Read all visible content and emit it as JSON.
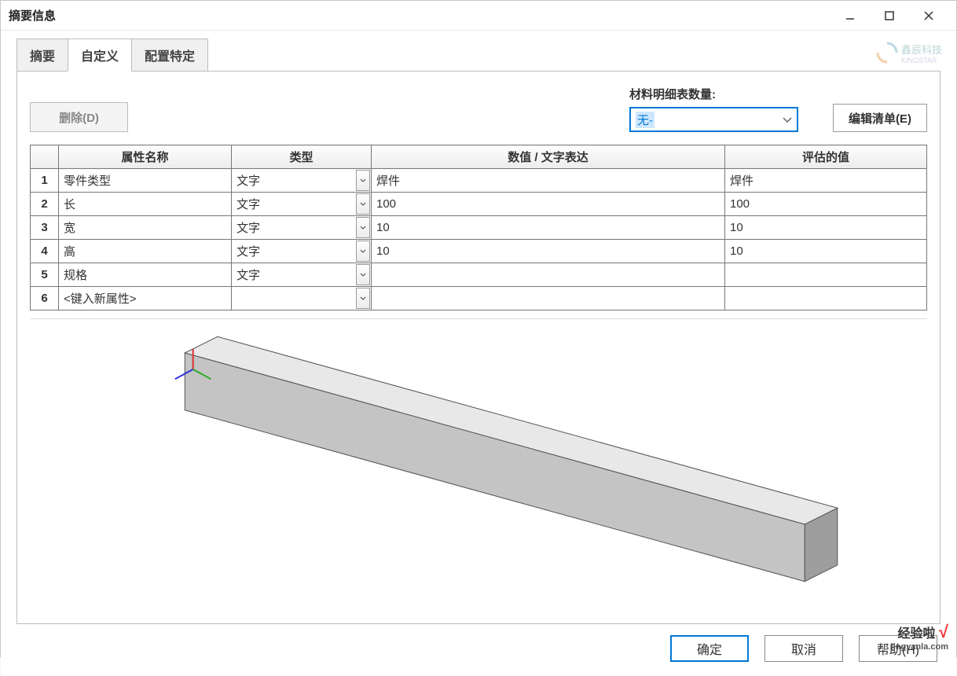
{
  "window": {
    "title": "摘要信息"
  },
  "tabs": {
    "t1": "摘要",
    "t2": "自定义",
    "t3": "配置特定"
  },
  "toolbar": {
    "delete_label": "删除(D)",
    "bom_label": "材料明细表数量:",
    "bom_value": "无-",
    "edit_list_label": "编辑清单(E)"
  },
  "table": {
    "headers": {
      "idx": "",
      "name": "属性名称",
      "type": "类型",
      "value": "数值 / 文字表达",
      "eval": "评估的值"
    },
    "rows": [
      {
        "idx": "1",
        "name": "零件类型",
        "type": "文字",
        "value": "焊件",
        "eval": "焊件"
      },
      {
        "idx": "2",
        "name": "长",
        "type": "文字",
        "value": "100",
        "eval": "100"
      },
      {
        "idx": "3",
        "name": "宽",
        "type": "文字",
        "value": "10",
        "eval": "10"
      },
      {
        "idx": "4",
        "name": "高",
        "type": "文字",
        "value": "10",
        "eval": "10"
      },
      {
        "idx": "5",
        "name": "规格",
        "type": "文字",
        "value": "",
        "eval": ""
      },
      {
        "idx": "6",
        "name": "<键入新属性>",
        "type": "",
        "value": "",
        "eval": ""
      }
    ]
  },
  "footer": {
    "ok": "确定",
    "cancel": "取消",
    "help": "帮助(H)"
  },
  "logo": {
    "text1": "鑫辰科技",
    "text2": "KINGSTAR"
  },
  "watermark": {
    "main": "经验啦",
    "url": "jingyanla.com"
  }
}
